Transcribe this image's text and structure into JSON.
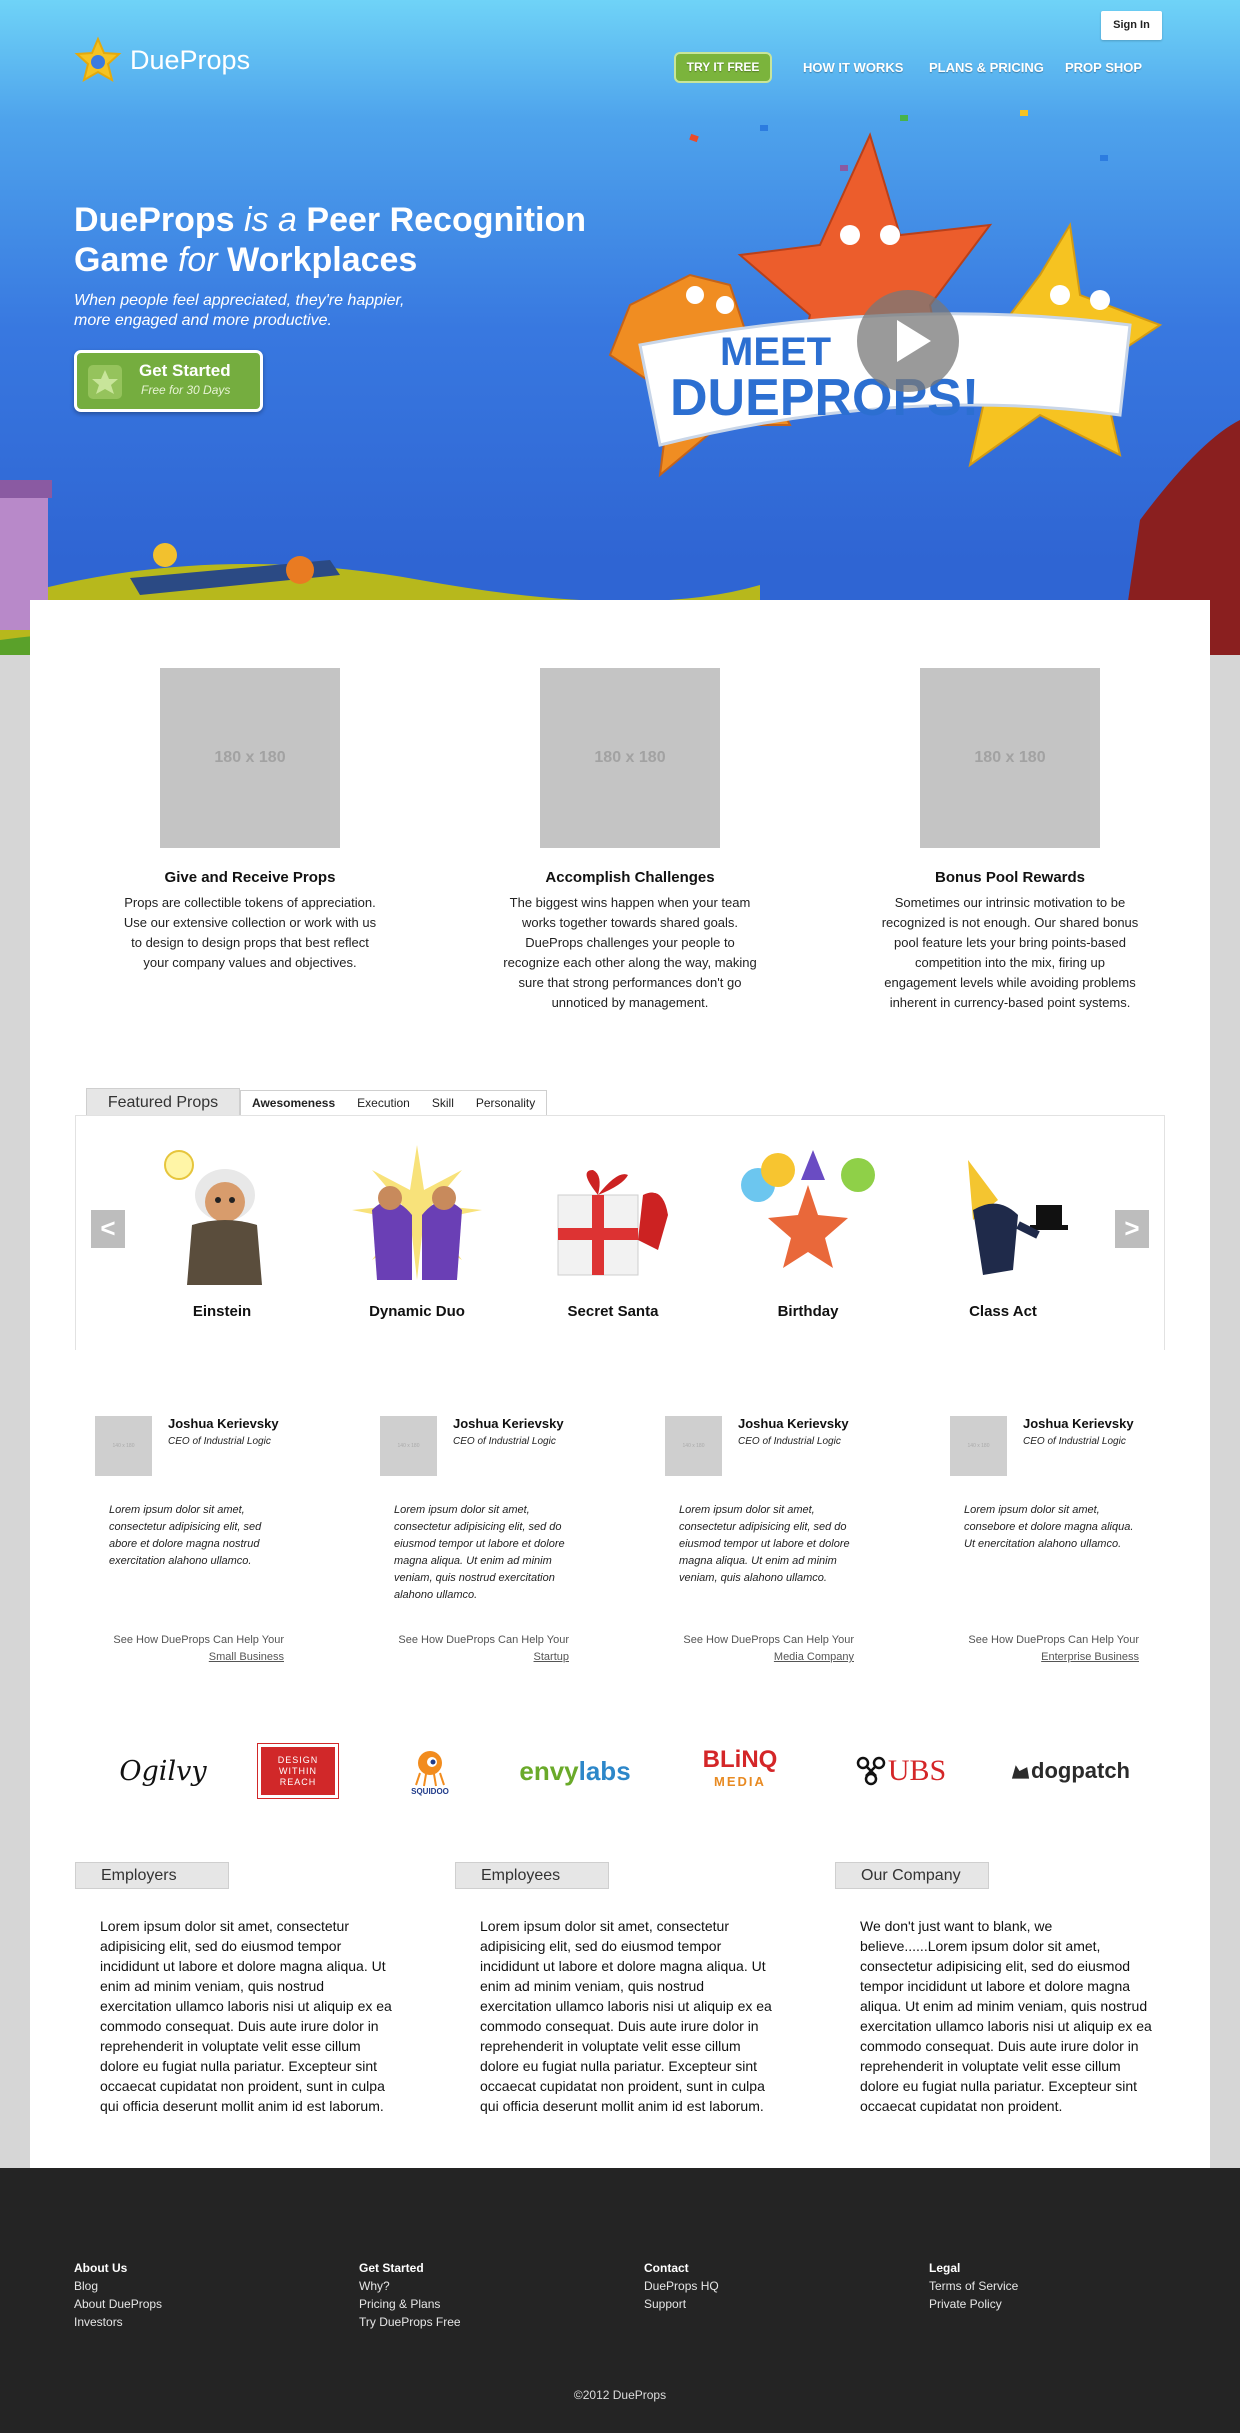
{
  "header": {
    "signin_label": "Sign In",
    "logo_text": "DueProps",
    "nav": {
      "try": "TRY IT FREE",
      "how": "HOW IT WORKS",
      "plans": "PLANS & PRICING",
      "shop": "PROP SHOP"
    }
  },
  "hero": {
    "headline_brand": "DueProps",
    "headline_is_a": " is a ",
    "headline_mid": "Peer Recognition",
    "headline_game": "Game ",
    "headline_for": "for",
    "headline_end": " Workplaces",
    "subhead": "When people feel appreciated, they're happier, more engaged and more productive.",
    "cta_title": "Get Started",
    "cta_sub": "Free for 30 Days",
    "banner_text_1": "MEET",
    "banner_text_2": "DUEPROPS!"
  },
  "features": [
    {
      "placeholder": "180 x 180",
      "title": "Give and Receive Props",
      "text": "Props are collectible tokens of appreciation. Use our extensive collection or work with us to design to design props that best reflect your company values and objectives."
    },
    {
      "placeholder": "180 x 180",
      "title": "Accomplish Challenges",
      "text": "The biggest wins happen when your team works together towards shared goals. DueProps challenges your people to recognize each other along the way, making sure that strong performances don't go unnoticed by management."
    },
    {
      "placeholder": "180 x 180",
      "title": "Bonus Pool Rewards",
      "text": "Sometimes our intrinsic motivation to be recognized is not enough. Our shared bonus pool feature lets your bring points-based competition into the mix, firing up engagement levels while avoiding problems inherent in currency-based point systems."
    }
  ],
  "featured_props": {
    "heading": "Featured Props",
    "tabs": [
      "Awesomeness",
      "Execution",
      "Skill",
      "Personality"
    ],
    "prev_label": "<",
    "next_label": ">",
    "props": [
      "Einstein",
      "Dynamic Duo",
      "Secret Santa",
      "Birthday",
      "Class Act"
    ]
  },
  "testimonials": [
    {
      "avatar": "140 x 180",
      "name": "Joshua Kerievsky",
      "title": "CEO of Industrial Logic",
      "quote": "Lorem ipsum dolor sit amet, consectetur adipisicing elit, sed abore et dolore magna nostrud exercitation alahono ullamco.",
      "cta_prefix": "See How DueProps Can Help Your ",
      "cta_link": "Small Business"
    },
    {
      "avatar": "140 x 180",
      "name": "Joshua Kerievsky",
      "title": "CEO of Industrial Logic",
      "quote": "Lorem ipsum dolor sit amet, consectetur adipisicing elit, sed do eiusmod tempor ut labore et dolore magna aliqua. Ut enim ad minim veniam, quis nostrud exercitation alahono ullamco.",
      "cta_prefix": "See How DueProps Can Help Your ",
      "cta_link": "Startup"
    },
    {
      "avatar": "140 x 180",
      "name": "Joshua Kerievsky",
      "title": "CEO of Industrial Logic",
      "quote": "Lorem ipsum dolor sit amet, consectetur adipisicing elit, sed do eiusmod tempor ut labore et dolore magna aliqua. Ut enim ad minim veniam, quis alahono ullamco.",
      "cta_prefix": "See How DueProps Can Help Your ",
      "cta_link": "Media Company"
    },
    {
      "avatar": "140 x 180",
      "name": "Joshua Kerievsky",
      "title": "CEO of Industrial Logic",
      "quote": "Lorem ipsum dolor sit amet, consebore et dolore magna aliqua. Ut enercitation alahono ullamco.",
      "cta_prefix": "See How DueProps Can Help Your ",
      "cta_link": "Enterprise Business"
    }
  ],
  "clients": {
    "ogilvy": "Ogilvy",
    "dwr": [
      "DESIGN",
      "WITHIN",
      "REACH"
    ],
    "squidoo": "SQUIDOO",
    "envy": "envy",
    "envy_labs": "labs",
    "blinq": "BLiNQ",
    "blinq_media": "MEDIA",
    "ubs": "UBS",
    "dogpatch": "dogpatch"
  },
  "columns": [
    {
      "title": "Employers",
      "text": "Lorem ipsum dolor sit amet, consectetur adipisicing elit, sed do eiusmod tempor incididunt ut labore et dolore magna aliqua. Ut enim ad minim veniam, quis nostrud exercitation ullamco laboris nisi ut aliquip ex ea commodo consequat. Duis aute irure dolor in reprehenderit in voluptate velit esse cillum dolore eu fugiat nulla pariatur. Excepteur sint occaecat cupidatat non proident, sunt in culpa qui officia deserunt mollit anim id est laborum."
    },
    {
      "title": "Employees",
      "text": "Lorem ipsum dolor sit amet, consectetur adipisicing elit, sed do eiusmod tempor incididunt ut labore et dolore magna aliqua. Ut enim ad minim veniam, quis nostrud exercitation ullamco laboris nisi ut aliquip ex ea commodo consequat. Duis aute irure dolor in reprehenderit in voluptate velit esse cillum dolore eu fugiat nulla pariatur. Excepteur sint occaecat cupidatat non proident, sunt in culpa qui officia deserunt mollit anim id est laborum."
    },
    {
      "title": "Our Company",
      "text": "We don't just want to blank, we believe......Lorem ipsum dolor sit amet, consectetur adipisicing elit, sed do eiusmod tempor incididunt ut labore et dolore magna aliqua. Ut enim ad minim veniam, quis nostrud exercitation ullamco laboris nisi ut aliquip ex ea commodo consequat. Duis aute irure dolor in reprehenderit in voluptate velit esse cillum dolore eu fugiat nulla pariatur. Excepteur sint occaecat cupidatat non proident."
    }
  ],
  "footer": {
    "cols": [
      {
        "title": "About Us",
        "links": [
          "Blog",
          "About DueProps",
          "Investors"
        ]
      },
      {
        "title": "Get Started",
        "links": [
          "Why?",
          "Pricing & Plans",
          "Try DueProps Free"
        ]
      },
      {
        "title": "Contact",
        "links": [
          "DueProps HQ",
          "Support"
        ]
      },
      {
        "title": "Legal",
        "links": [
          "Terms of Service",
          "Private Policy"
        ]
      }
    ],
    "copyright": "©2012 DueProps"
  },
  "colors": {
    "hero_sky": "#3878e0",
    "accent_green": "#7bb43c",
    "footer_bg": "#242424",
    "placeholder_gray": "#c4c4c4"
  }
}
